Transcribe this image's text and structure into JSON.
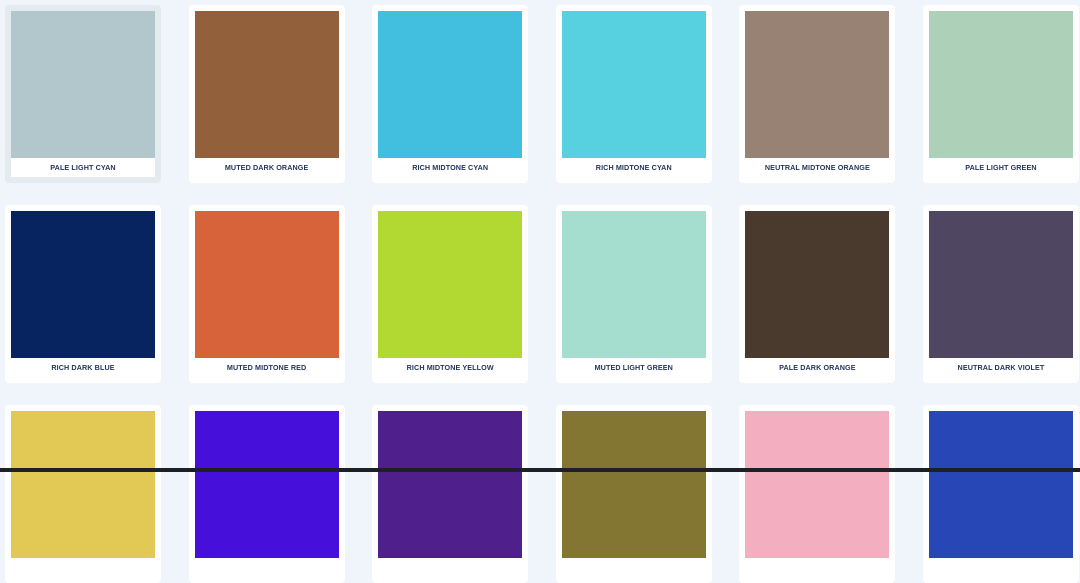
{
  "swatches": [
    {
      "label": "PALE LIGHT CYAN",
      "color": "#b1c7cb",
      "selected": true
    },
    {
      "label": "MUTED DARK ORANGE",
      "color": "#92603b"
    },
    {
      "label": "RICH MIDTONE CYAN",
      "color": "#42bfdf"
    },
    {
      "label": "RICH MIDTONE CYAN",
      "color": "#57d0df"
    },
    {
      "label": "NEUTRAL MIDTONE ORANGE",
      "color": "#978274"
    },
    {
      "label": "PALE LIGHT GREEN",
      "color": "#acd0b8"
    },
    {
      "label": "RICH DARK BLUE",
      "color": "#072461"
    },
    {
      "label": "MUTED MIDTONE RED",
      "color": "#d66339"
    },
    {
      "label": "RICH MIDTONE YELLOW",
      "color": "#b1d931"
    },
    {
      "label": "MUTED LIGHT GREEN",
      "color": "#a5ddcf"
    },
    {
      "label": "PALE DARK ORANGE",
      "color": "#4a392d"
    },
    {
      "label": "NEUTRAL DARK VIOLET",
      "color": "#4f4662"
    },
    {
      "label": "",
      "color": "#e2c854"
    },
    {
      "label": "",
      "color": "#4710da"
    },
    {
      "label": "",
      "color": "#4f1f8b"
    },
    {
      "label": "",
      "color": "#827632"
    },
    {
      "label": "",
      "color": "#f3aebf"
    },
    {
      "label": "",
      "color": "#2747b7"
    }
  ]
}
